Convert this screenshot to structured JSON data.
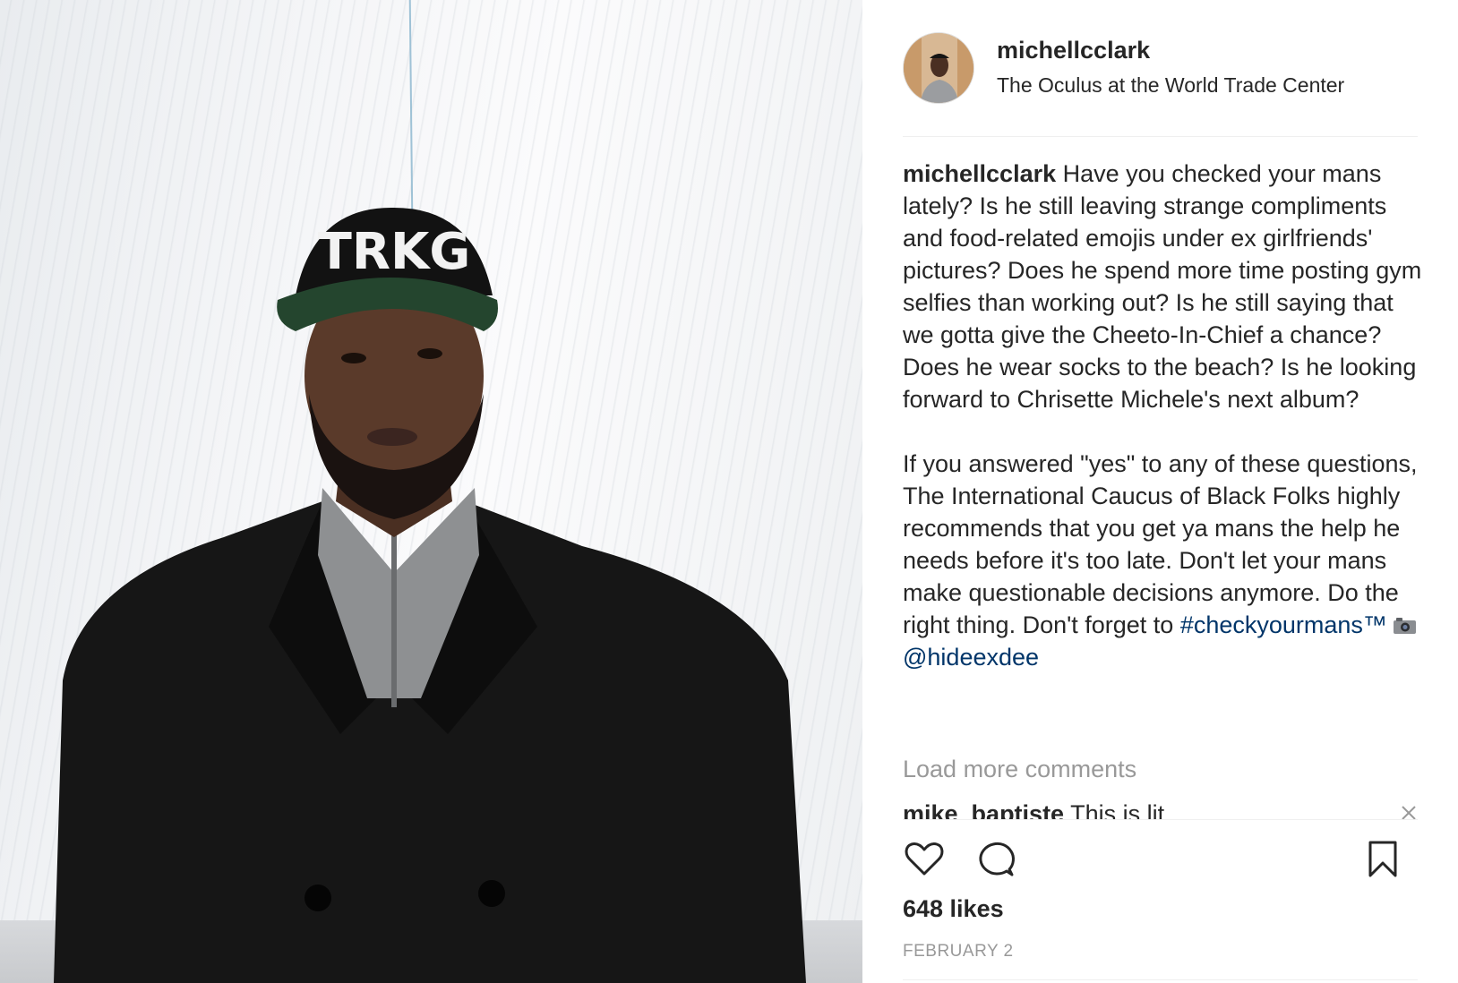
{
  "post": {
    "username": "michellcclark",
    "location": "The Oculus at the World Trade Center"
  },
  "caption": {
    "username": "michellcclark",
    "text": "Have you checked your mans lately? Is he still leaving strange compliments and food-related emojis under ex girlfriends' pictures? Does he spend more time posting gym selfies than working out? Is he still saying that we gotta give the Cheeto-In-Chief a chance? Does he wear socks to the beach? Is he looking forward to Chrisette Michele's next album?\n\nIf you answered \"yes\" to any of these questions, The International Caucus of Black Folks highly recommends that you get ya mans the help he needs before it's too late. Don't let your mans make questionable decisions anymore. Do the right thing. Don't forget to ",
    "hashtag": "#checkyourmans™",
    "mention": "@hideexdee"
  },
  "load_more_label": "Load more comments",
  "comment": {
    "username": "mike_baptiste",
    "text": "This is lit"
  },
  "likes_label": "648 likes",
  "date_label": "FEBRUARY 2",
  "icons": {
    "like": "heart-icon",
    "comment": "speech-bubble-icon",
    "save": "bookmark-icon",
    "camera": "camera-emoji-icon",
    "close": "close-icon"
  },
  "photo": {
    "cap_text": "TRKG"
  }
}
